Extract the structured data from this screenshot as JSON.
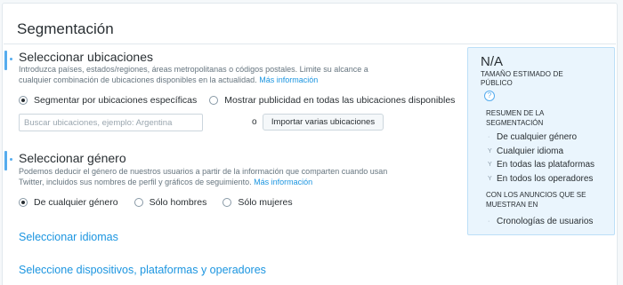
{
  "page": {
    "title": "Segmentación"
  },
  "locations": {
    "title": "Seleccionar ubicaciones",
    "description": "Introduzca países, estados/regiones, áreas metropolitanas o códigos postales. Limite su alcance a cualquier combinación de ubicaciones disponibles en la actualidad.",
    "more_info": "Más información",
    "options": [
      {
        "label": "Segmentar por ubicaciones específicas",
        "selected": true
      },
      {
        "label": "Mostrar publicidad en todas las ubicaciones disponibles",
        "selected": false
      }
    ],
    "search_placeholder": "Buscar ubicaciones, ejemplo: Argentina",
    "or_text": "o",
    "import_button": "Importar varias ubicaciones"
  },
  "gender": {
    "title": "Seleccionar género",
    "description": "Podemos deducir el género de nuestros usuarios a partir de la información que comparten cuando usan Twitter, incluidos sus nombres de perfil y gráficos de seguimiento.",
    "more_info": "Más información",
    "options": [
      {
        "label": "De cualquier género",
        "selected": true
      },
      {
        "label": "Sólo hombres",
        "selected": false
      },
      {
        "label": "Sólo mujeres",
        "selected": false
      }
    ]
  },
  "languages_link": "Seleccionar idiomas",
  "devices_link": "Seleccione dispositivos, plataformas y operadores",
  "summary_panel": {
    "estimate_value": "N/A",
    "estimate_label": "TAMAÑO ESTIMADO DE PÚBLICO",
    "help_glyph": "?",
    "summary_title": "RESUMEN DE LA SEGMENTACIÓN",
    "summary_items": [
      "De cualquier género",
      "Cualquier idioma",
      "En todas las plataformas",
      "En todos los operadores"
    ],
    "bullet_glyph": "Y",
    "dot_glyph": "·",
    "placements_title": "CON LOS ANUNCIOS QUE SE MUESTRAN EN",
    "placements_items": [
      "Cronologías de usuarios"
    ]
  },
  "colors": {
    "accent": "#55acee",
    "link": "#1b95e0",
    "panel_bg": "#eaf5fd",
    "panel_border": "#bcdff7"
  }
}
